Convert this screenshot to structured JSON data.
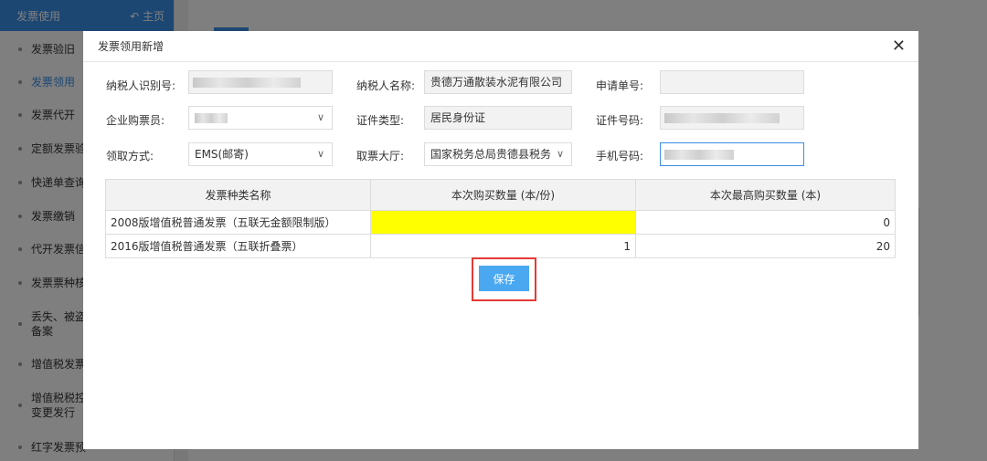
{
  "sidebar": {
    "title": "发票使用",
    "home": "主页",
    "items": [
      {
        "label": "发票验旧"
      },
      {
        "label": "发票领用"
      },
      {
        "label": "发票代开"
      },
      {
        "label": "定额发票验"
      },
      {
        "label": "快递单查询"
      },
      {
        "label": "发票缴销"
      },
      {
        "label": "代开发票信"
      },
      {
        "label": "发票票种核"
      },
      {
        "label": "丢失、被盗",
        "label2": "备案"
      },
      {
        "label": "增值税发票"
      },
      {
        "label": "增值税税控",
        "label2": "变更发行"
      },
      {
        "label": "红字发票预"
      }
    ]
  },
  "modal": {
    "title": "发票领用新增",
    "fields": {
      "taxpayer_id_label": "纳税人识别号:",
      "taxpayer_name_label": "纳税人名称:",
      "taxpayer_name_value": "贵德万通散装水泥有限公司",
      "application_no_label": "申请单号:",
      "buyer_label": "企业购票员:",
      "id_type_label": "证件类型:",
      "id_type_value": "居民身份证",
      "id_no_label": "证件号码:",
      "pickup_label": "领取方式:",
      "pickup_value": "EMS(邮寄)",
      "hall_label": "取票大厅:",
      "hall_value": "国家税务总局贵德县税务",
      "phone_label": "手机号码:"
    },
    "table": {
      "headers": [
        "发票种类名称",
        "本次购买数量 (本/份)",
        "本次最高购买数量 (本)"
      ],
      "rows": [
        {
          "name": "2008版增值税普通发票（五联无金额限制版）",
          "qty": "",
          "max": "0"
        },
        {
          "name": "2016版增值税普通发票（五联折叠票）",
          "qty": "1",
          "max": "20"
        }
      ]
    },
    "save_label": "保存"
  },
  "colors": {
    "accent": "#3a8ee6",
    "save_button": "#4aa8f0",
    "highlight": "#ffff00",
    "annotation_box": "#e53935"
  }
}
